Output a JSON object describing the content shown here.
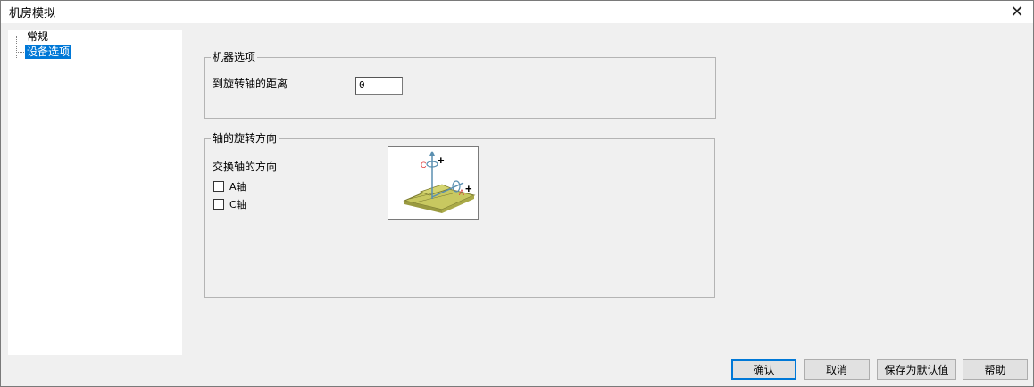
{
  "window": {
    "title": "机房模拟",
    "close_glyph": "✕"
  },
  "tree": {
    "items": [
      {
        "label": "常规",
        "selected": false
      },
      {
        "label": "设备选项",
        "selected": true
      }
    ]
  },
  "machine_options": {
    "legend": "机器选项",
    "distance_label": "到旋转轴的距离",
    "distance_value": "0"
  },
  "rotation_direction": {
    "legend": "轴的旋转方向",
    "swap_label": "交换轴的方向",
    "checkbox_a": {
      "label": "A轴",
      "checked": false
    },
    "checkbox_c": {
      "label": "C轴",
      "checked": false
    },
    "diagram_c_label": "C",
    "diagram_a_label": "A"
  },
  "buttons": {
    "ok": "确认",
    "cancel": "取消",
    "save_default": "保存为默认值",
    "help": "帮助"
  },
  "colors": {
    "selection": "#0078d7",
    "axis_red": "#e04040",
    "plate": "#c8c860"
  }
}
